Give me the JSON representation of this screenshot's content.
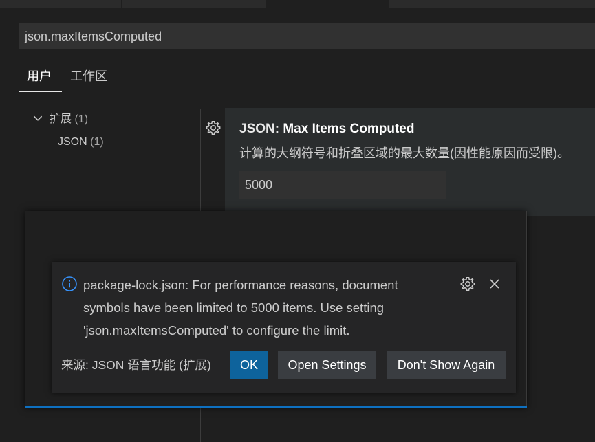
{
  "search": {
    "value": "json.maxItemsComputed"
  },
  "scope_tabs": [
    {
      "label": "用户"
    },
    {
      "label": "工作区"
    }
  ],
  "toc": {
    "group_label": "扩展",
    "group_count": "(1)",
    "child_label": "JSON",
    "child_count": "(1)"
  },
  "setting": {
    "category": "JSON: ",
    "name": "Max Items Computed",
    "description": "计算的大纲符号和折叠区域的最大数量(因性能原因而受限)。",
    "value": "5000",
    "icon": "gear-icon"
  },
  "notification": {
    "icon": "info-icon",
    "message": "package-lock.json: For performance reasons, document symbols have been limited to 5000 items. Use setting 'json.maxItemsComputed' to configure the limit.",
    "source": "来源: JSON 语言功能 (扩展)",
    "buttons": {
      "ok": "OK",
      "open_settings": "Open Settings",
      "dont_show": "Don't Show Again"
    }
  },
  "colors": {
    "accent": "#0e639c",
    "info": "#3794ff",
    "progress": "#0e70c0"
  }
}
